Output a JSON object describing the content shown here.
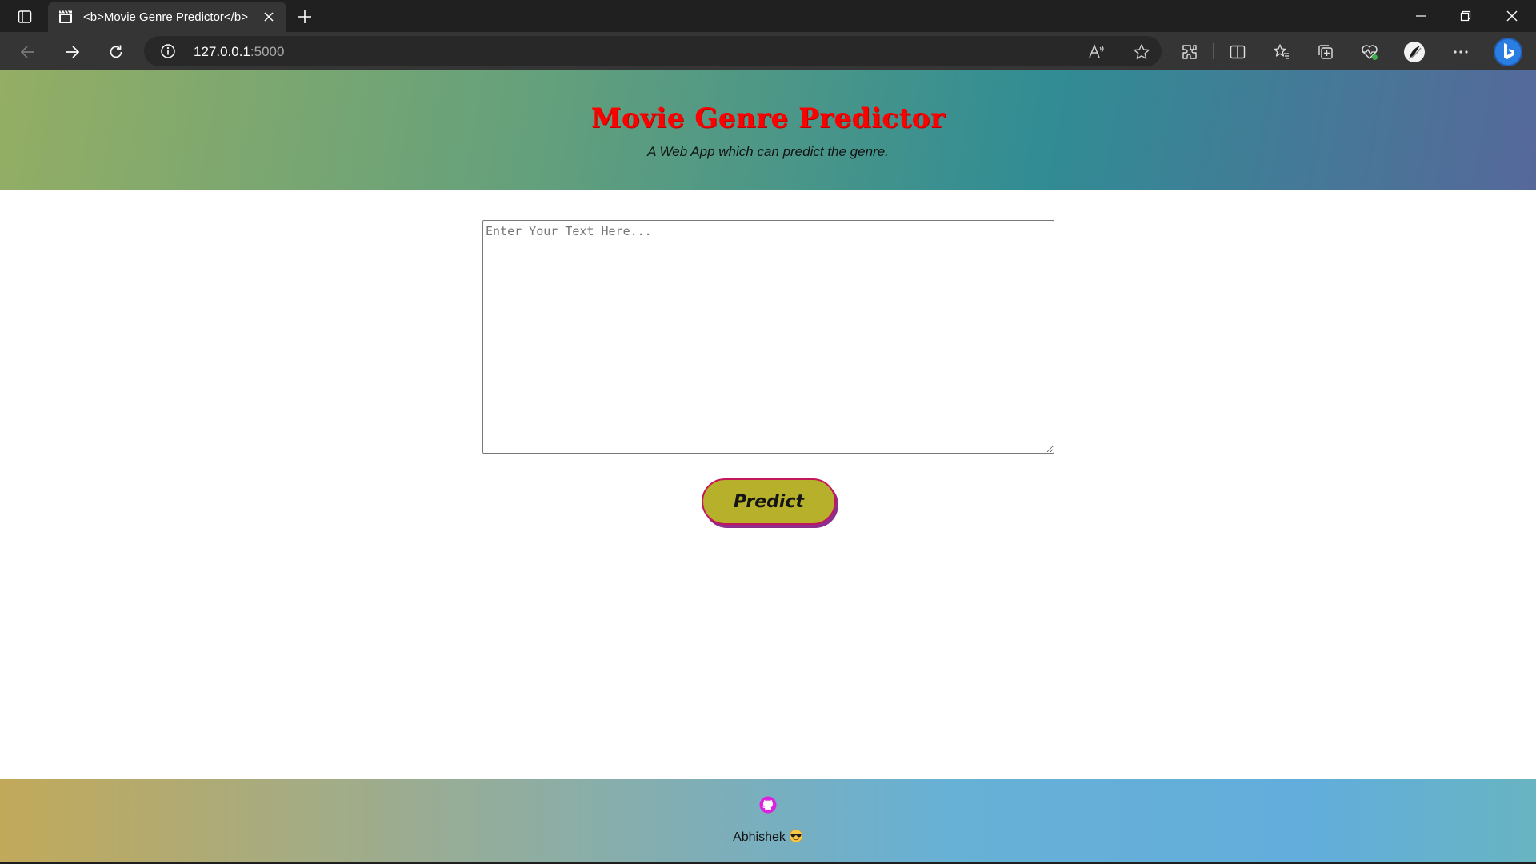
{
  "browser": {
    "tab": {
      "title": "<b>Movie Genre Predictor</b>",
      "favicon": "clapperboard-icon"
    },
    "address": {
      "host": "127.0.0.1",
      "port": ":5000"
    },
    "icons": [
      "tab-actions-icon",
      "new-tab-icon",
      "back-icon",
      "forward-icon",
      "refresh-icon",
      "site-info-icon",
      "read-aloud-icon",
      "favorite-star-icon",
      "extensions-icon",
      "split-screen-icon",
      "favorites-icon",
      "collections-icon",
      "browser-essentials-icon",
      "profile-icon",
      "more-menu-icon",
      "bing-copilot-icon",
      "minimize-icon",
      "restore-icon",
      "close-window-icon"
    ]
  },
  "header": {
    "title": "Movie Genre Predictor",
    "subtitle": "A Web App which can predict the genre."
  },
  "form": {
    "placeholder": "Enter Your Text Here...",
    "value": "",
    "button_label": "Predict"
  },
  "footer": {
    "author": "Abhishek",
    "github_icon": "github-icon",
    "emoji": "smiling-face-with-sunglasses"
  },
  "colors": {
    "title": "#ff0000",
    "button_fill": "#b6b02a",
    "button_border": "#c2185b",
    "button_shadow": "#8e2d8c",
    "github_icon": "#e020e0"
  }
}
